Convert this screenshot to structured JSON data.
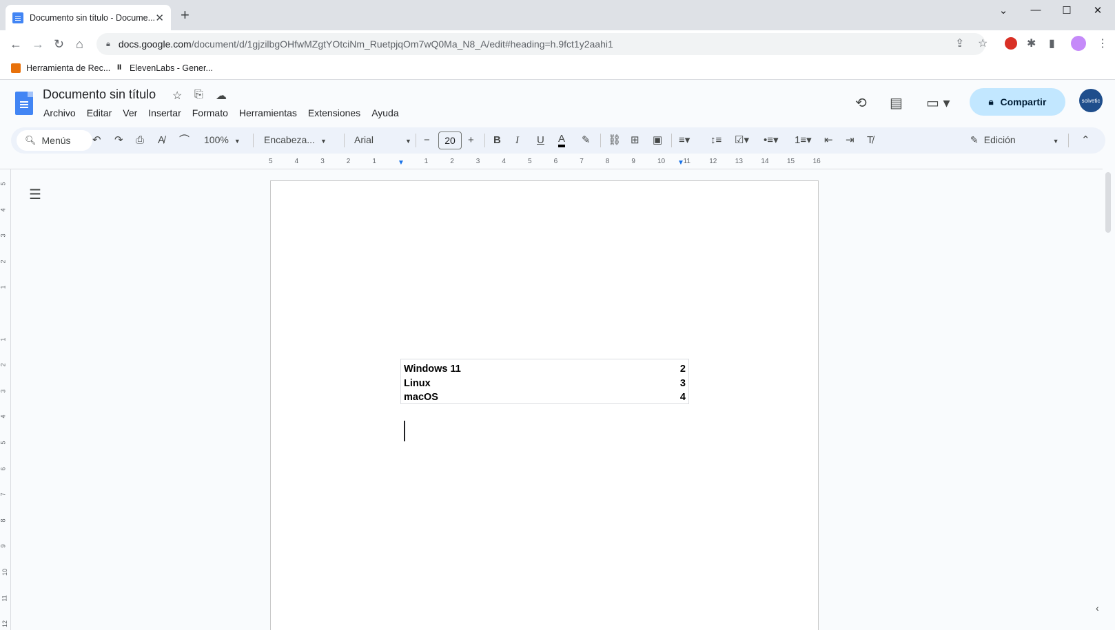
{
  "browser": {
    "tab_title": "Documento sin título - Docume...",
    "url_host": "docs.google.com",
    "url_path": "/document/d/1gjzilbgOHfwMZgtYOtciNm_RuetpjqOm7wQ0Ma_N8_A/edit#heading=h.9fct1y2aahi1",
    "bookmarks": [
      {
        "label": "Herramienta de Rec..."
      },
      {
        "label": "ElevenLabs - Gener..."
      }
    ]
  },
  "docs": {
    "title": "Documento sin título",
    "menu": [
      "Archivo",
      "Editar",
      "Ver",
      "Insertar",
      "Formato",
      "Herramientas",
      "Extensiones",
      "Ayuda"
    ],
    "share_label": "Compartir",
    "avatar_text": "solvetic"
  },
  "toolbar": {
    "menus_search": "Menús",
    "zoom": "100%",
    "style": "Encabeza...",
    "font": "Arial",
    "font_size": "20",
    "mode": "Edición"
  },
  "ruler": {
    "ticks": [
      "5",
      "4",
      "3",
      "2",
      "1",
      "",
      "1",
      "2",
      "3",
      "4",
      "5",
      "6",
      "7",
      "8",
      "9",
      "10",
      "11",
      "12",
      "13",
      "14",
      "15",
      "16"
    ]
  },
  "document": {
    "toc": [
      {
        "label": "Windows 11",
        "page": "2"
      },
      {
        "label": "Linux",
        "page": "3"
      },
      {
        "label": "macOS",
        "page": "4"
      }
    ]
  },
  "colors": {
    "accent": "#4285f4",
    "share_bg": "#c2e7ff",
    "toolbar_bg": "#edf2fa"
  }
}
